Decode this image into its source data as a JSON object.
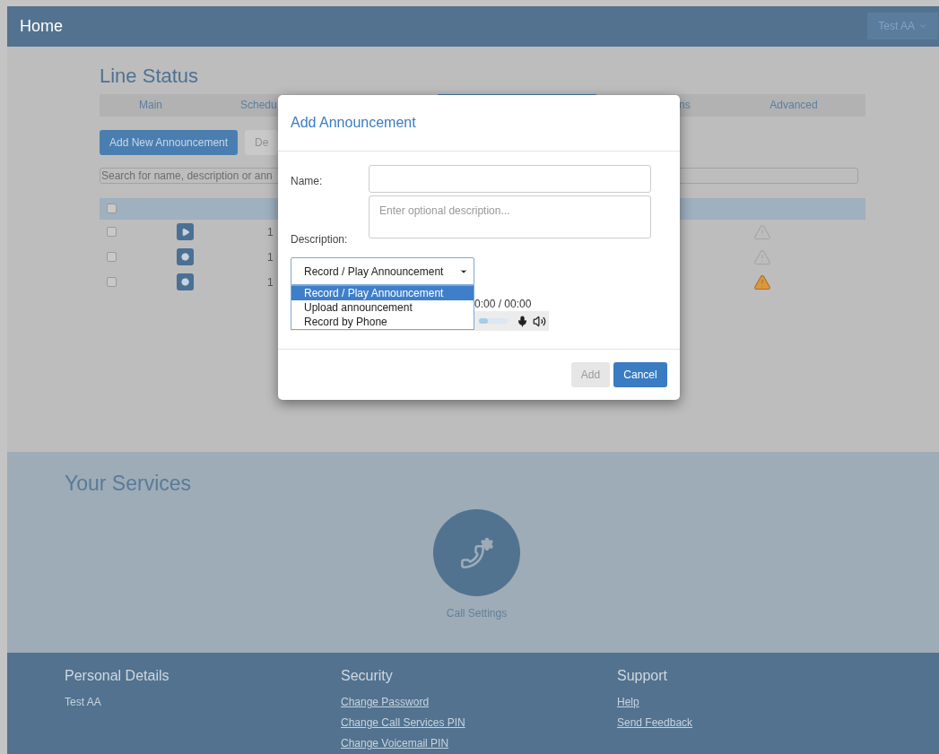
{
  "navbar": {
    "title": "Home",
    "user_menu": "Test AA"
  },
  "page_title": "Line Status",
  "tabs": [
    {
      "label": "Main",
      "selected": false
    },
    {
      "label": "Schedu",
      "selected": false
    },
    {
      "selected": true
    },
    {
      "label": "ns",
      "selected": false
    },
    {
      "label": "Advanced",
      "selected": false
    }
  ],
  "actions": [
    {
      "label": "Add New Announcement",
      "disabled": false
    },
    {
      "label": "De",
      "disabled": true
    }
  ],
  "search": {
    "placeholder": "Search for name, description or ann"
  },
  "table": {
    "header_checked": false,
    "rows": [
      {
        "checked": false,
        "kind": "play",
        "column_3": "1",
        "warning": false
      },
      {
        "checked": false,
        "kind": "record",
        "column_3": "1",
        "warning": false
      },
      {
        "checked": false,
        "kind": "record",
        "column_3": "1",
        "warning": true
      }
    ]
  },
  "modal": {
    "title": "Add Announcement",
    "name_label": "Name:",
    "description_label": "Description:",
    "description_placeholder": "Enter optional description...",
    "mode_select": "Record / Play Announcement",
    "mode_options": [
      {
        "label": "Record / Play Announcement",
        "selected": true
      },
      {
        "label": "Upload announcement",
        "selected": false
      },
      {
        "label": "Record by Phone",
        "selected": false
      }
    ],
    "player": {
      "time": "0:00 / 00:00",
      "level": 0.3
    },
    "buttons": [
      {
        "label": "Add",
        "disabled": true
      },
      {
        "label": "Cancel",
        "disabled": false
      }
    ]
  },
  "services": {
    "title": "Your Services",
    "items": [
      {
        "label": "Call Settings"
      }
    ]
  },
  "footer": {
    "columns": [
      {
        "heading": "Personal Details",
        "items": [
          {
            "text": "Test AA",
            "kind": "text"
          }
        ]
      },
      {
        "heading": "Security",
        "items": [
          {
            "text": "Change Password",
            "kind": "link"
          },
          {
            "text": "Change Call Services PIN",
            "kind": "link"
          },
          {
            "text": "Change Voicemail PIN",
            "kind": "link"
          }
        ]
      },
      {
        "heading": "Support",
        "items": [
          {
            "text": "Help",
            "kind": "link"
          },
          {
            "text": "Send Feedback",
            "kind": "link"
          }
        ]
      }
    ]
  }
}
